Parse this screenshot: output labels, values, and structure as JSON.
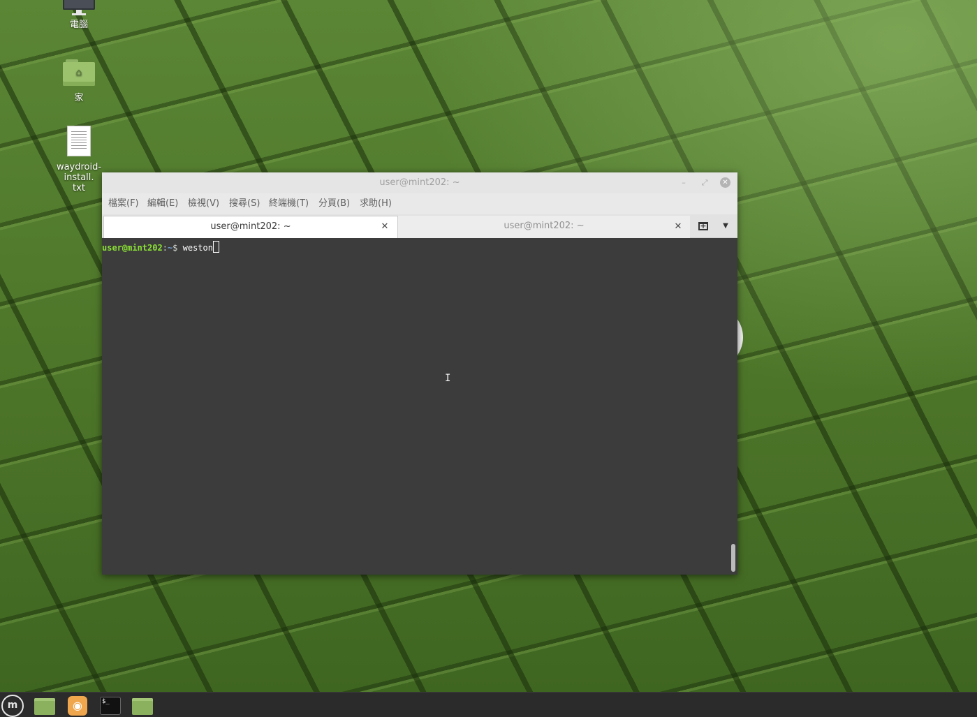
{
  "desktop": {
    "icons": [
      {
        "label": "電腦",
        "icon": "computer-icon"
      },
      {
        "label": "家",
        "icon": "home-folder-icon"
      },
      {
        "label": "waydroid-install.\ntxt",
        "icon": "text-file-icon"
      }
    ]
  },
  "terminal_window": {
    "title": "user@mint202: ~",
    "controls": {
      "minimize": "–",
      "maximize": "⤢",
      "close": "✕"
    },
    "menu": [
      {
        "label": "檔案(F)"
      },
      {
        "label": "編輯(E)"
      },
      {
        "label": "檢視(V)"
      },
      {
        "label": "搜尋(S)"
      },
      {
        "label": "終端機(T)"
      },
      {
        "label": "分頁(B)"
      },
      {
        "label": "求助(H)"
      }
    ],
    "tabs": [
      {
        "label": "user@mint202: ~",
        "active": true,
        "close": "✕"
      },
      {
        "label": "user@mint202: ~",
        "active": false,
        "close": "✕"
      }
    ],
    "tab_tools": {
      "new_tab": "+",
      "dropdown": "▼"
    },
    "prompt": {
      "user_host": "user@mint202",
      "separator": ":",
      "path": "~",
      "symbol": "$ ",
      "command": "weston"
    },
    "mouse_cursor": "I"
  },
  "taskbar": {
    "items": [
      {
        "name": "mint-menu",
        "glyph": "m"
      },
      {
        "name": "files",
        "glyph": ""
      },
      {
        "name": "firefox",
        "glyph": "◉"
      },
      {
        "name": "terminal",
        "glyph": "$_"
      },
      {
        "name": "files",
        "glyph": ""
      }
    ]
  },
  "colors": {
    "desktop_green": "#4f7a2b",
    "terminal_bg": "#3c3c3c",
    "prompt_user": "#8ae234",
    "prompt_path": "#729fcf",
    "taskbar": "#2b2b2b"
  }
}
